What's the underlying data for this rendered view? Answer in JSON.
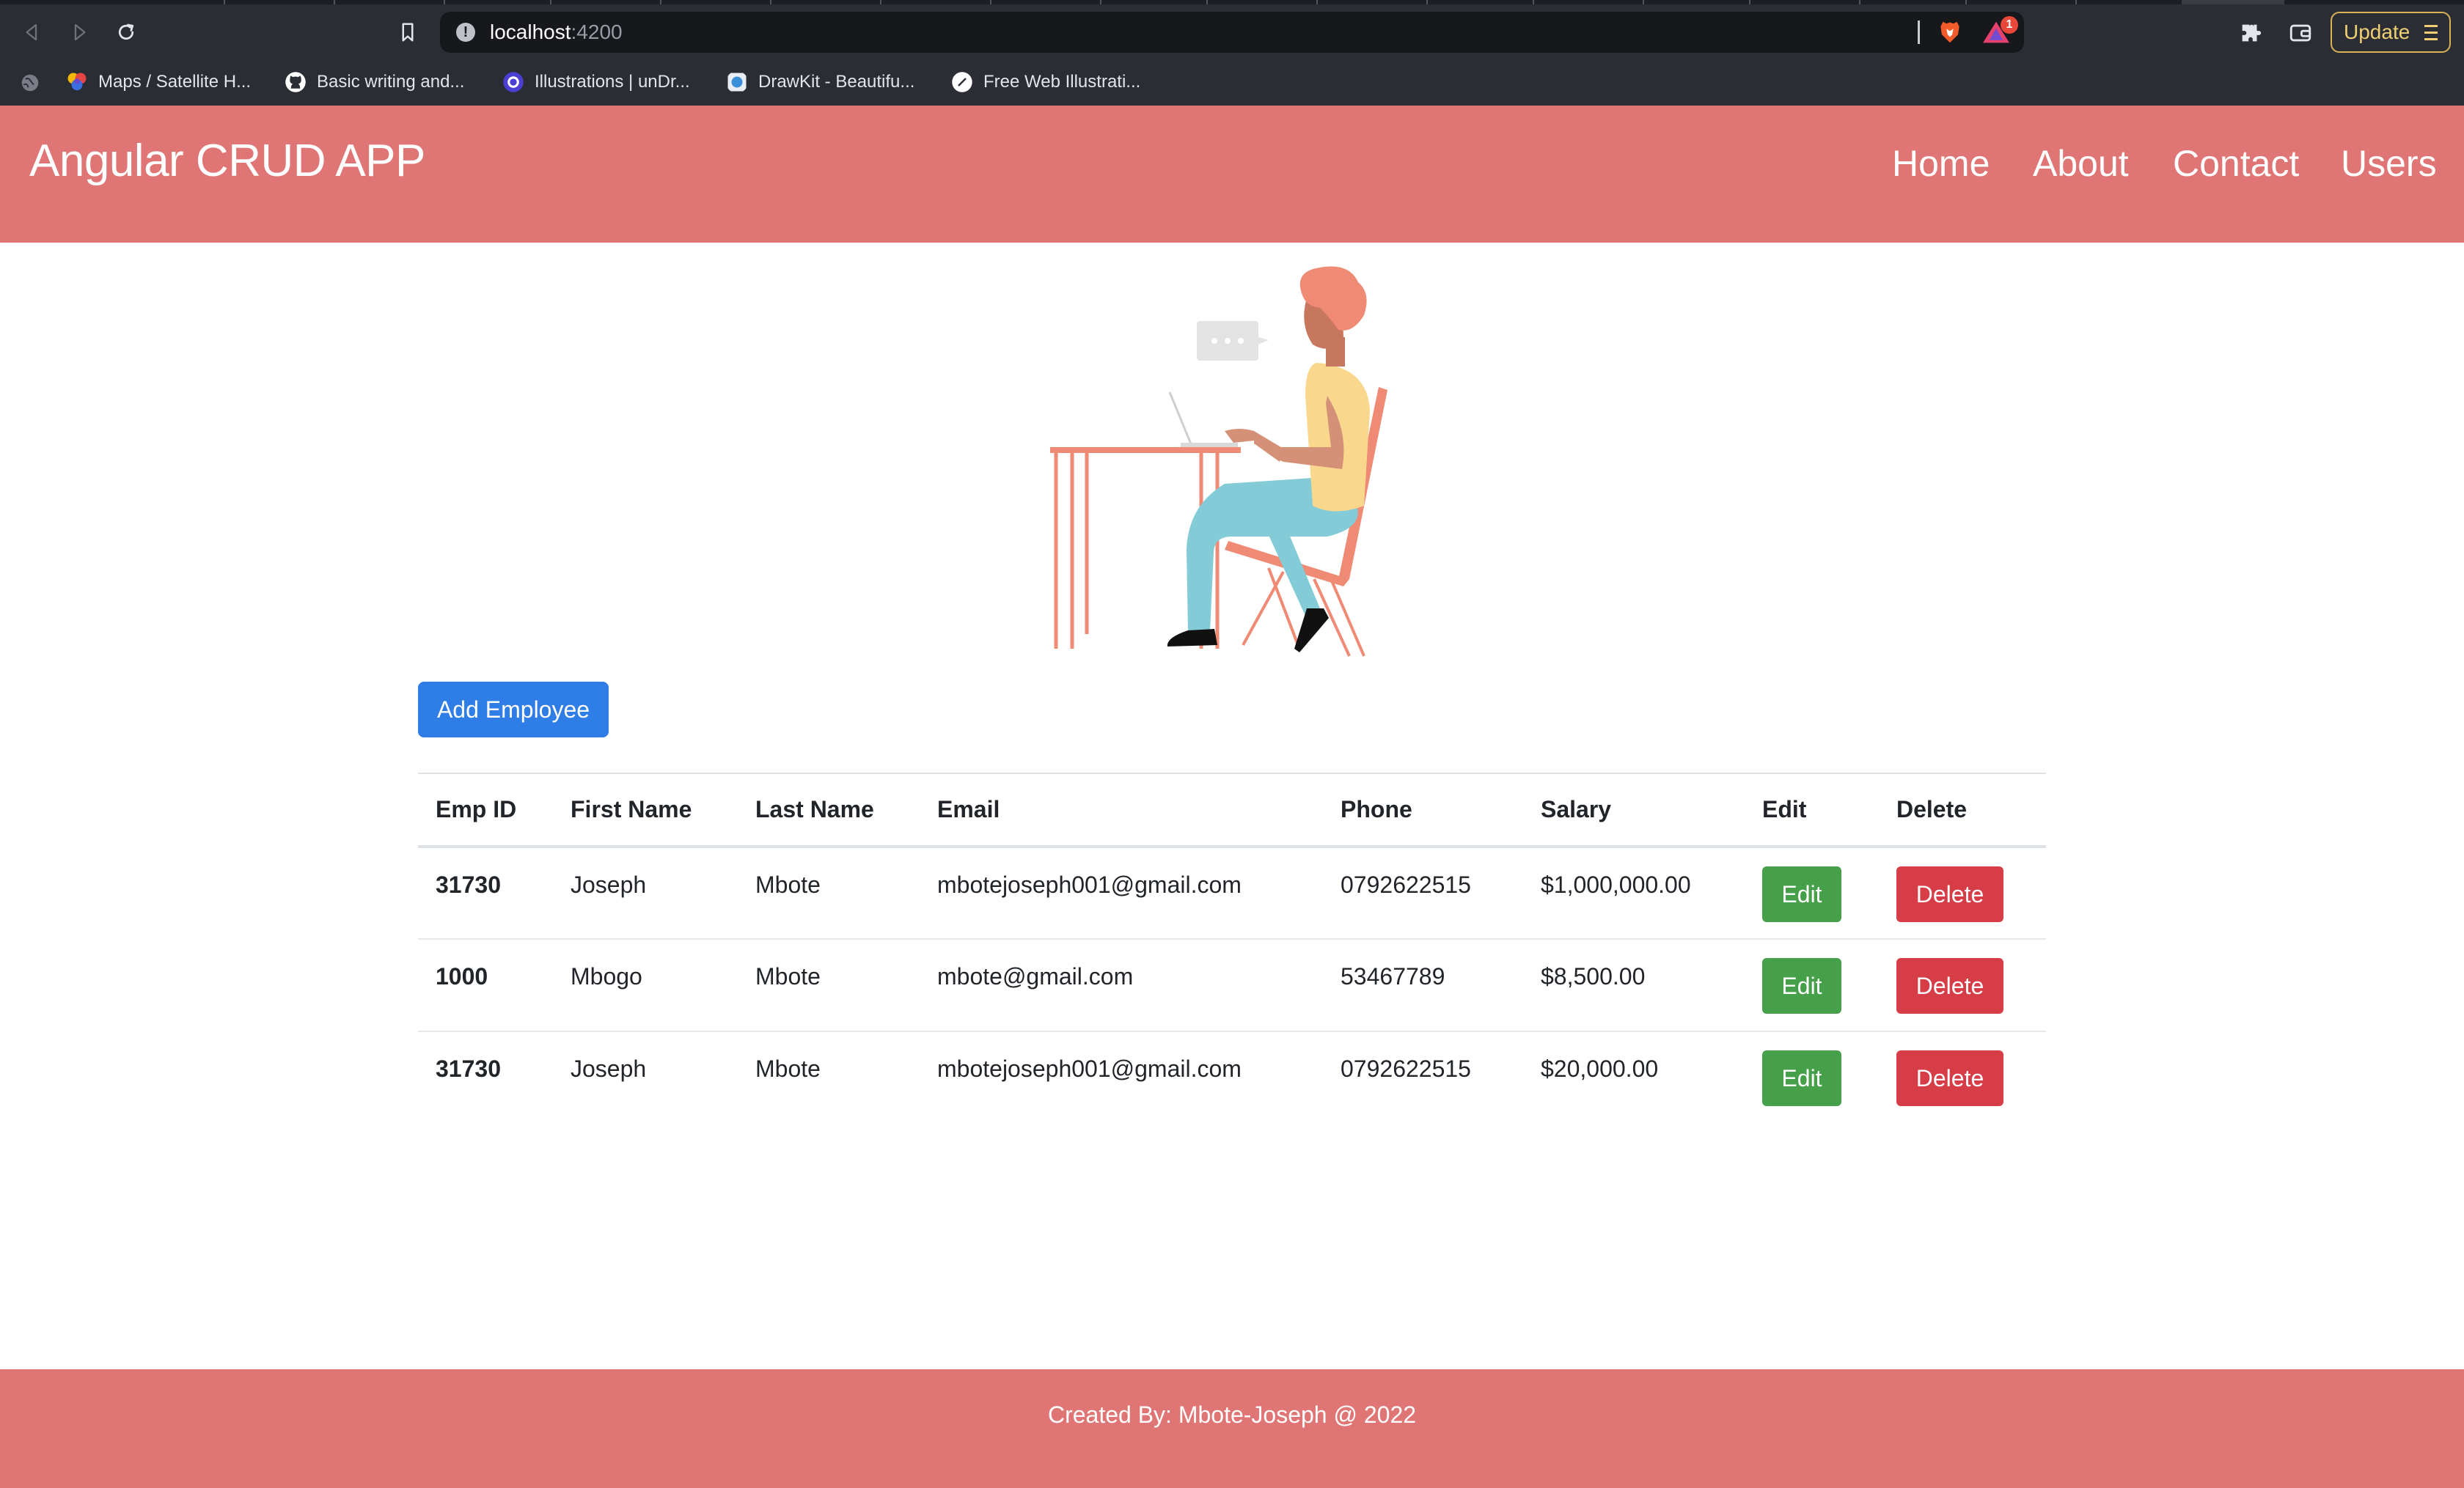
{
  "browser": {
    "url_host": "localhost",
    "url_port": ":4200",
    "rewards_badge": "1",
    "update_label": "Update",
    "bookmarks": [
      {
        "label": "Maps / Satellite H...",
        "icon": "maps-favicon"
      },
      {
        "label": "Basic writing and...",
        "icon": "github-favicon"
      },
      {
        "label": "Illustrations | unDr...",
        "icon": "undraw-favicon"
      },
      {
        "label": "DrawKit - Beautifu...",
        "icon": "drawkit-favicon"
      },
      {
        "label": "Free Web Illustrati...",
        "icon": "web-illustrations-favicon"
      }
    ]
  },
  "navbar": {
    "brand": "Angular CRUD APP",
    "links": [
      "Home",
      "About",
      "Contact",
      "Users"
    ]
  },
  "main": {
    "add_button": "Add Employee",
    "table": {
      "headers": [
        "Emp ID",
        "First Name",
        "Last Name",
        "Email",
        "Phone",
        "Salary",
        "Edit",
        "Delete"
      ],
      "rows": [
        {
          "id": "31730",
          "first": "Joseph",
          "last": "Mbote",
          "email": "mbotejoseph001@gmail.com",
          "phone": "0792622515",
          "salary": "$1,000,000.00"
        },
        {
          "id": "1000",
          "first": "Mbogo",
          "last": "Mbote",
          "email": "mbote@gmail.com",
          "phone": "53467789",
          "salary": "$8,500.00"
        },
        {
          "id": "31730",
          "first": "Joseph",
          "last": "Mbote",
          "email": "mbotejoseph001@gmail.com",
          "phone": "0792622515",
          "salary": "$20,000.00"
        }
      ],
      "edit_label": "Edit",
      "delete_label": "Delete"
    }
  },
  "footer": {
    "text": "Created By: Mbote-Joseph @ 2022"
  },
  "colors": {
    "accent": "#e07575",
    "primary_button": "#2f7de6",
    "edit_button": "#46a049",
    "delete_button": "#d63d47",
    "chrome_bg": "#2b2d35"
  }
}
